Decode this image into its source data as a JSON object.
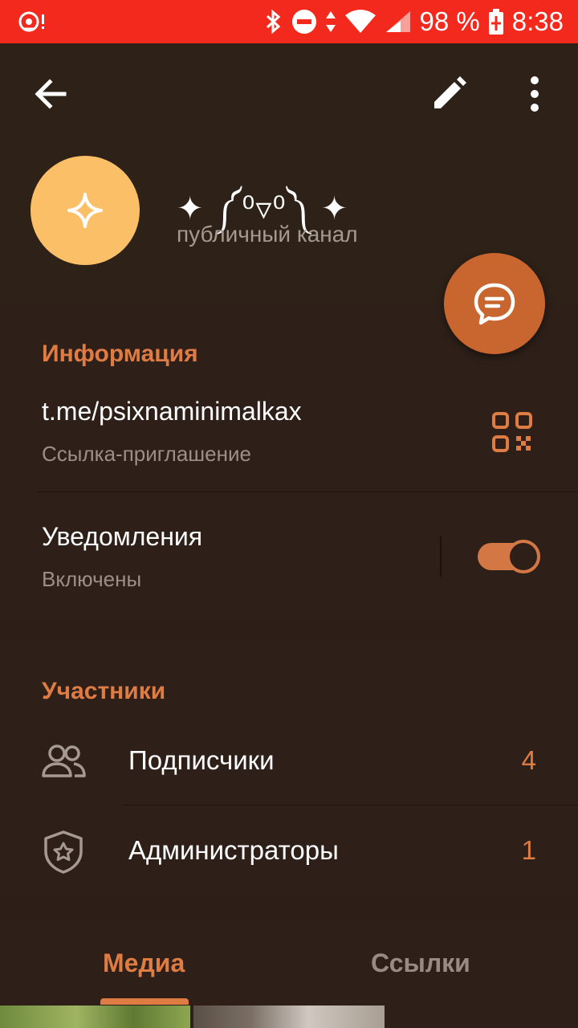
{
  "status_bar": {
    "battery": "98 %",
    "time": "8:38",
    "colors": {
      "background": "#f3291e"
    }
  },
  "toolbar": {
    "back_icon": "arrow-left-icon",
    "edit_icon": "pencil-icon",
    "more_icon": "more-vertical-icon"
  },
  "channel": {
    "title": "✦ ༼⁰▿⁰༽ ✦",
    "subtitle": "публичный канал",
    "avatar_icon": "sparkle-icon",
    "avatar_color": "#fbbf67"
  },
  "fab": {
    "icon": "chat-bubble-icon",
    "color": "#c9662f"
  },
  "info": {
    "section_title": "Информация",
    "link": "t.me/psixnaminimalkax",
    "link_caption": "Ссылка-приглашение",
    "qr_icon": "qr-code-icon",
    "notifications_label": "Уведомления",
    "notifications_state": "Включены",
    "notifications_enabled": true
  },
  "members": {
    "section_title": "Участники",
    "items": [
      {
        "icon": "users-icon",
        "label": "Подписчики",
        "count": "4"
      },
      {
        "icon": "shield-star-icon",
        "label": "Администраторы",
        "count": "1"
      }
    ]
  },
  "tabs": {
    "items": [
      {
        "label": "Медиа",
        "active": true
      },
      {
        "label": "Ссылки",
        "active": false
      }
    ],
    "accent": "#de7c44"
  }
}
